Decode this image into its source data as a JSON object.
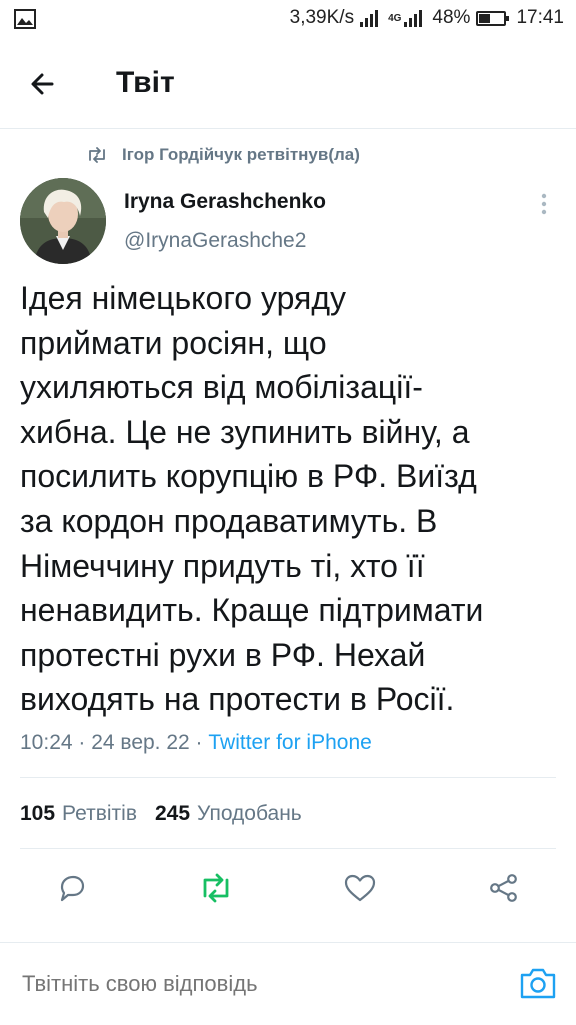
{
  "status_bar": {
    "speed": "3,39K/s",
    "network": "4G",
    "battery": "48%",
    "time": "17:41"
  },
  "header": {
    "title": "Твіт"
  },
  "tweet": {
    "retweeted_by": "Ігор Гордійчук ретвітнув(ла)",
    "author_name": "Iryna Gerashchenko",
    "author_handle": "@IrynaGerashche2",
    "text_lines": [
      "Ідея німецького уряду",
      "приймати росіян, що",
      "ухиляються від мобілізації-",
      "хибна. Це не зупинить війну, а",
      "посилить корупцію в РФ. Виїзд",
      "за кордон продаватимуть. В",
      "Німеччину придуть ті, хто її",
      "ненавидить. Краще підтримати",
      "протестні рухи в РФ. Нехай",
      "виходять на протести в Росії."
    ],
    "time": "10:24 · 24 вер. 22 ·",
    "source": "Twitter for iPhone"
  },
  "stats": {
    "retweets_count": "105",
    "retweets_label": "Ретвітів",
    "likes_count": "245",
    "likes_label": "Уподобань"
  },
  "actions": [
    "reply-icon",
    "retweet-icon",
    "like-icon",
    "share-icon"
  ],
  "reply_bar": {
    "placeholder": "Твітніть свою відповідь"
  },
  "colors": {
    "accent": "#1da1f2",
    "retweet_green": "#17bf63",
    "secondary_text": "#657786",
    "primary_text": "#14171a",
    "divider": "#e6ecf0"
  }
}
